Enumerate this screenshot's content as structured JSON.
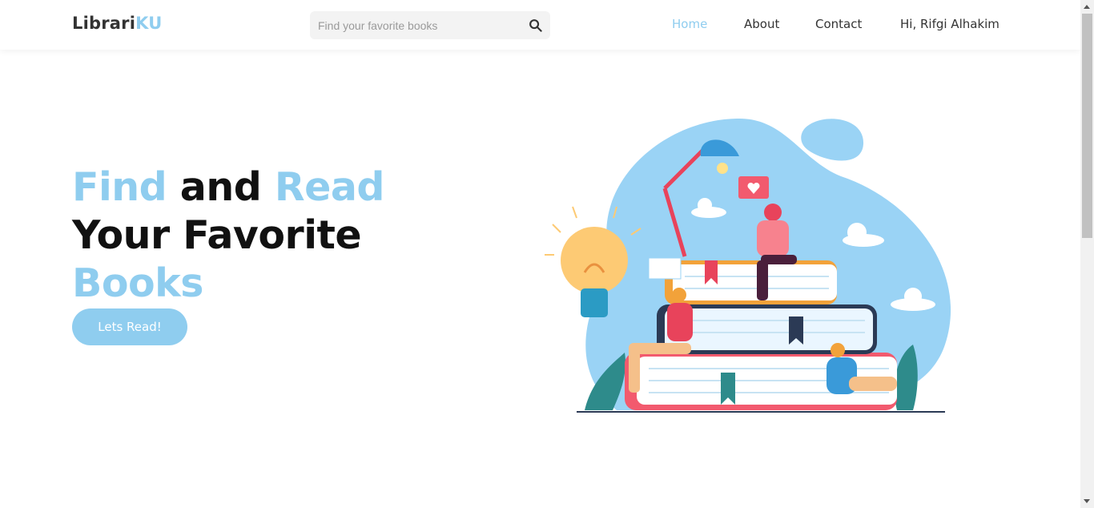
{
  "brand": {
    "name": "Librari",
    "accent": "KU"
  },
  "search": {
    "placeholder": "Find your favorite books",
    "value": "",
    "icon": "search-icon"
  },
  "nav": {
    "items": [
      {
        "label": "Home",
        "active": true
      },
      {
        "label": "About",
        "active": false
      },
      {
        "label": "Contact",
        "active": false
      }
    ],
    "greeting": "Hi, Rifgi Alhakim"
  },
  "hero": {
    "w1": "Find",
    "w2": " and ",
    "w3": "Read",
    "line2": "Your Favorite",
    "line3": "Books",
    "cta": "Lets Read!"
  },
  "colors": {
    "accent": "#8fcdef",
    "text": "#111111",
    "nav_text": "#333333",
    "blob": "#9ad3f5"
  }
}
